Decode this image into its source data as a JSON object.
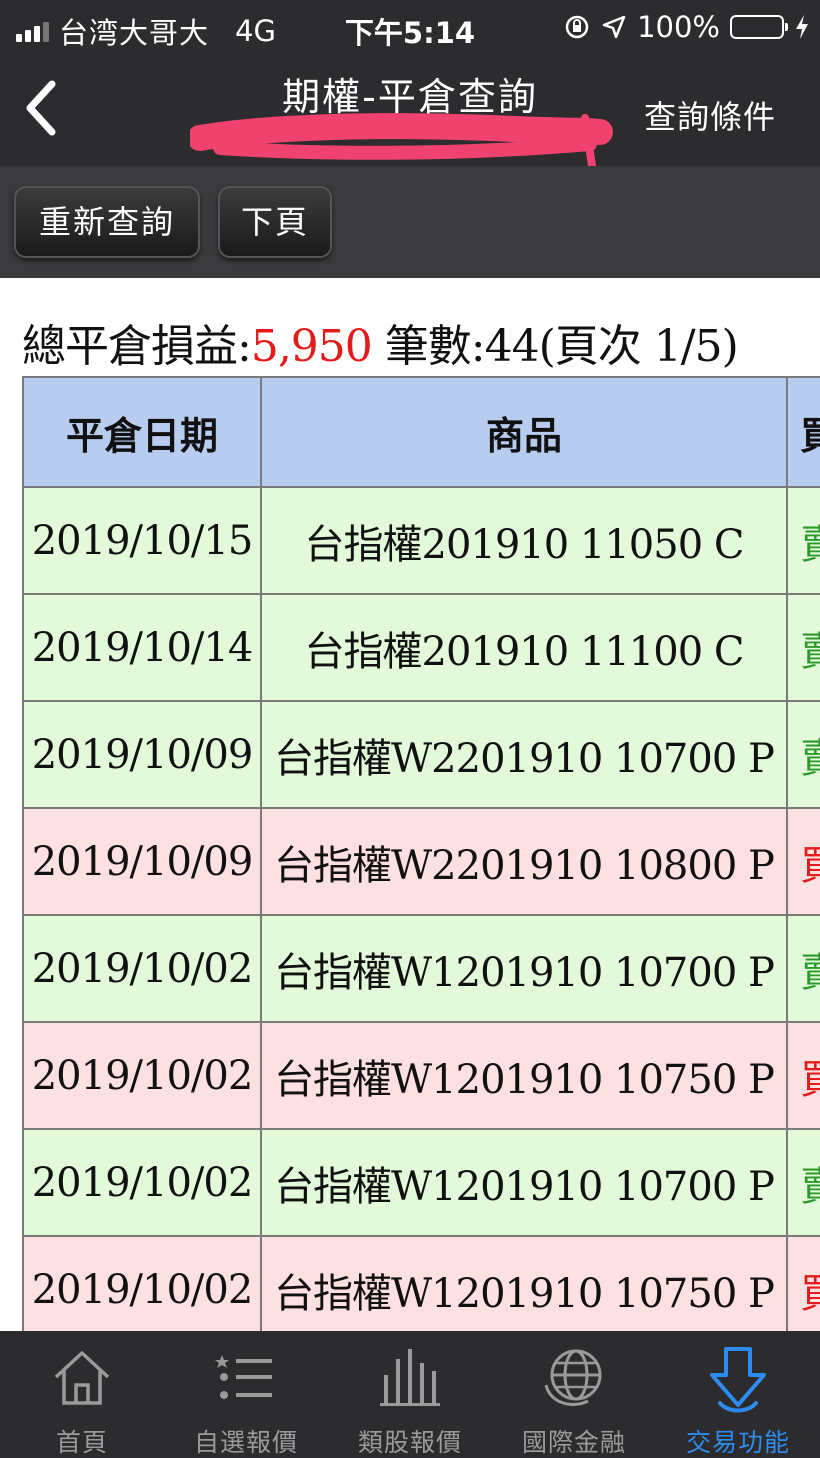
{
  "status_bar": {
    "carrier": "台湾大哥大",
    "network": "4G",
    "time": "下午5:14",
    "battery": "100%",
    "battery_level": 1.0
  },
  "nav": {
    "back_icon": "chevron-left-icon",
    "title": "期權-平倉查詢",
    "right_action": "查詢條件"
  },
  "toolbar": {
    "refresh_label": "重新查詢",
    "next_label": "下頁"
  },
  "summary": {
    "pnl_label": "總平倉損益:",
    "pnl_value": "5,950",
    "count_label": " 筆數:",
    "count_value": "44",
    "page_info": "(頁次 1/5)"
  },
  "table": {
    "headers": [
      "平倉日期",
      "商品",
      "買"
    ],
    "rows": [
      {
        "date": "2019/10/15",
        "product": "台指權201910 11050 C",
        "side": "賣",
        "color": "green"
      },
      {
        "date": "2019/10/14",
        "product": "台指權201910 11100 C",
        "side": "賣",
        "color": "green"
      },
      {
        "date": "2019/10/09",
        "product": "台指權W2201910 10700 P",
        "side": "賣",
        "color": "green"
      },
      {
        "date": "2019/10/09",
        "product": "台指權W2201910 10800 P",
        "side": "買",
        "color": "red"
      },
      {
        "date": "2019/10/02",
        "product": "台指權W1201910 10700 P",
        "side": "賣",
        "color": "green"
      },
      {
        "date": "2019/10/02",
        "product": "台指權W1201910 10750 P",
        "side": "買",
        "color": "red"
      },
      {
        "date": "2019/10/02",
        "product": "台指權W1201910 10700 P",
        "side": "賣",
        "color": "green"
      },
      {
        "date": "2019/10/02",
        "product": "台指權W1201910 10750 P",
        "side": "買",
        "color": "red"
      }
    ]
  },
  "tabs": [
    {
      "label": "首頁",
      "icon": "home-icon",
      "active": false
    },
    {
      "label": "自選報價",
      "icon": "list-icon",
      "active": false
    },
    {
      "label": "類股報價",
      "icon": "bar-chart-icon",
      "active": false
    },
    {
      "label": "國際金融",
      "icon": "globe-icon",
      "active": false
    },
    {
      "label": "交易功能",
      "icon": "download-arrow-icon",
      "active": true
    }
  ],
  "colors": {
    "bar_bg": "#2c2c2e",
    "header_bg": "#b8ccf0",
    "row_green": "#e2fad9",
    "row_red": "#fde0e2",
    "profit_red": "#e31b1b",
    "active_tab": "#2d8cf0"
  }
}
